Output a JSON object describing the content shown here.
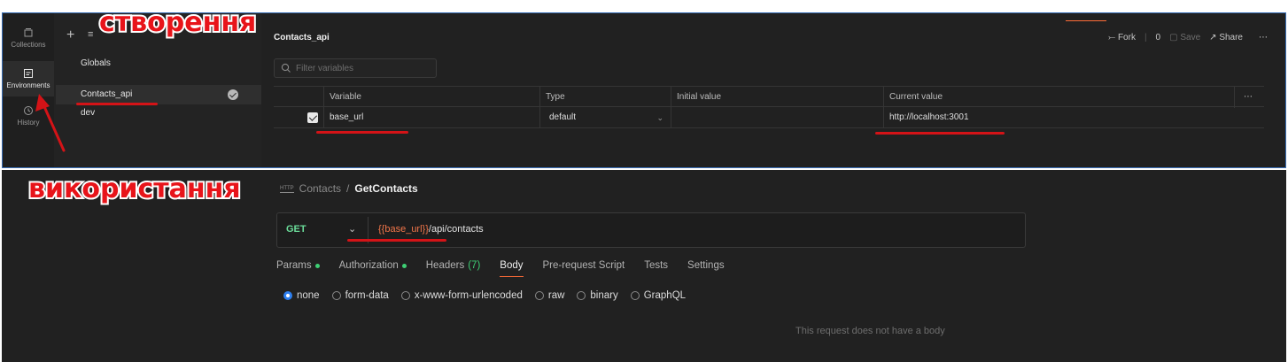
{
  "rail": {
    "collections": "Collections",
    "environments": "Environments",
    "history": "History"
  },
  "env_list": {
    "globals": "Globals",
    "items": [
      "Contacts_api",
      "dev"
    ]
  },
  "env_editor": {
    "title": "Contacts_api",
    "fork_label": "Fork",
    "fork_count": "0",
    "save_label": "Save",
    "share_label": "Share",
    "filter_placeholder": "Filter variables",
    "columns": [
      "Variable",
      "Type",
      "Initial value",
      "Current value"
    ],
    "rows": [
      {
        "enabled": true,
        "variable": "base_url",
        "type": "default",
        "initial_value": "",
        "current_value": "http://localhost:3001"
      }
    ]
  },
  "request": {
    "breadcrumb_collection": "Contacts",
    "breadcrumb_separator": "/",
    "breadcrumb_request": "GetContacts",
    "http_badge": "HTTP",
    "method": "GET",
    "url_variable": "{{base_url}}",
    "url_path": "/api/contacts",
    "tabs": {
      "params": "Params",
      "authorization": "Authorization",
      "headers": "Headers",
      "headers_count": "(7)",
      "body": "Body",
      "prerequest": "Pre-request Script",
      "tests": "Tests",
      "settings": "Settings"
    },
    "body_options": [
      "none",
      "form-data",
      "x-www-form-urlencoded",
      "raw",
      "binary",
      "GraphQL"
    ],
    "selected_body_option": "none",
    "empty_body_message": "This request does not have a body"
  },
  "annotations": {
    "creation": "створення",
    "usage": "використання",
    "color": "#e8141a"
  }
}
